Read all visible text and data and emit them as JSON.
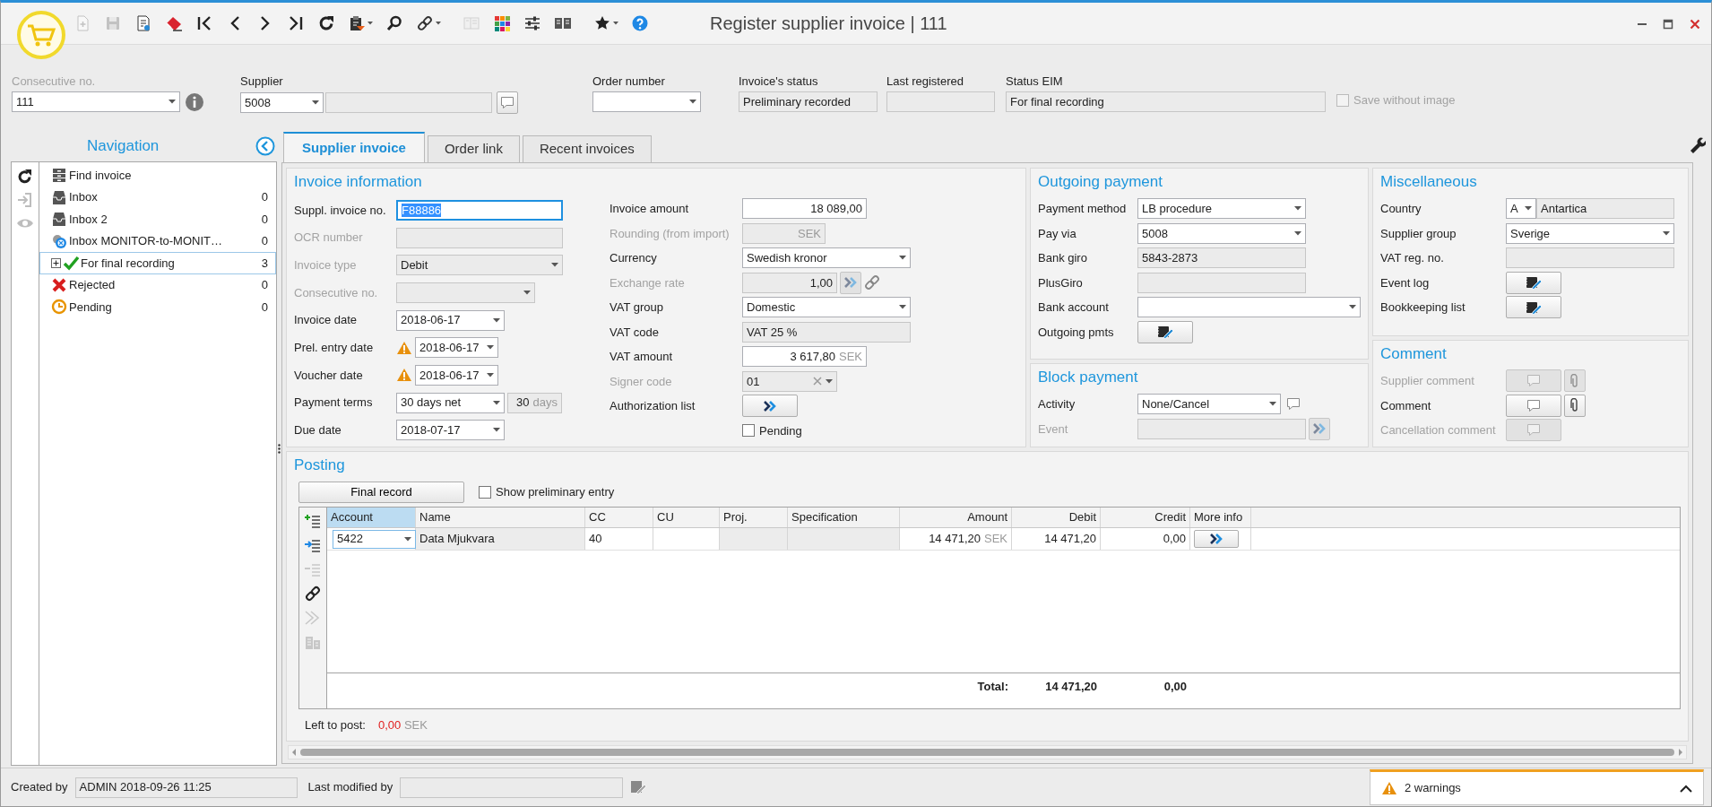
{
  "window": {
    "title": "Register supplier invoice | 111"
  },
  "toolbar": [
    {
      "disabled": true
    },
    {
      "disabled": true
    },
    {
      "disabled": false
    },
    {
      "disabled": false
    },
    {
      "disabled": false
    },
    {
      "disabled": false
    },
    {
      "disabled": false
    },
    {
      "disabled": false
    },
    {
      "disabled": false
    },
    {
      "disabled": false
    },
    {
      "disabled": false
    },
    {
      "disabled": false
    },
    {
      "disabled": true
    },
    {
      "disabled": false
    },
    {
      "disabled": false
    },
    {
      "disabled": false
    },
    {
      "disabled": false
    },
    {
      "disabled": false
    }
  ],
  "header_fields": [
    {
      "label": "Consecutive no.",
      "value": "111",
      "kind": "combo",
      "disabled": true
    },
    {
      "label": "Supplier",
      "value": "5008",
      "kind": "supplier",
      "disabled": false
    },
    {
      "label": "Order number",
      "kind": "combo",
      "disabled": false
    },
    {
      "label": "Invoice's status",
      "value": "Preliminary recorded",
      "kind": "readonly",
      "disabled": false
    },
    {
      "label": "Last registered",
      "kind": "readonly",
      "disabled": false
    },
    {
      "label": "Status EIM",
      "value": "For final recording",
      "kind": "readonly",
      "disabled": false
    }
  ],
  "save_without_image": {
    "label": "Save without image",
    "checked": false,
    "disabled": true
  },
  "navigation": {
    "title": "Navigation",
    "tools": [
      {
        "disabled": false
      },
      {
        "disabled": true
      },
      {
        "disabled": true
      }
    ],
    "items": [
      {
        "label": "Find invoice",
        "selected": false
      },
      {
        "label": "Inbox",
        "count": "0",
        "selected": false
      },
      {
        "label": "Inbox 2",
        "count": "0",
        "selected": false
      },
      {
        "label": "Inbox MONITOR-to-MONIT…",
        "count": "0",
        "selected": false
      },
      {
        "label": "For final recording",
        "count": "3",
        "selected": true,
        "expanded": false
      },
      {
        "label": "Rejected",
        "count": "0",
        "selected": false
      },
      {
        "label": "Pending",
        "count": "0",
        "selected": false
      }
    ]
  },
  "tabs": [
    {
      "label": "Supplier invoice",
      "selected": true
    },
    {
      "label": "Order link",
      "selected": false
    },
    {
      "label": "Recent invoices",
      "selected": false
    }
  ],
  "invoice_information": {
    "title": "Invoice information",
    "left": [
      {
        "label": "Suppl. invoice no.",
        "value": "F88886",
        "kind": "text",
        "focused": true,
        "disabled": false
      },
      {
        "label": "OCR number",
        "kind": "readonly",
        "disabled": true
      },
      {
        "label": "Invoice type",
        "value": "Debit",
        "kind": "combo",
        "disabled": true
      },
      {
        "label": "Consecutive no.",
        "kind": "combo",
        "disabled": true
      },
      {
        "label": "Invoice date",
        "value": "2018-06-17",
        "kind": "date",
        "warning": false,
        "disabled": false
      },
      {
        "label": "Prel. entry date",
        "value": "2018-06-17",
        "kind": "date",
        "warning": true,
        "disabled": false
      },
      {
        "label": "Voucher date",
        "value": "2018-06-17",
        "kind": "date",
        "warning": true,
        "disabled": false
      },
      {
        "label": "Payment terms",
        "value": "30 days net",
        "kind": "terms",
        "days": "30",
        "days_unit": "days",
        "disabled": false
      },
      {
        "label": "Due date",
        "value": "2018-07-17",
        "kind": "date",
        "warning": false,
        "disabled": false
      }
    ],
    "right": [
      {
        "label": "Invoice amount",
        "value": "18 089,00",
        "kind": "amount",
        "disabled": false
      },
      {
        "label": "Rounding (from import)",
        "unit": "SEK",
        "kind": "amount",
        "disabled": true
      },
      {
        "label": "Currency",
        "value": "Swedish kronor",
        "kind": "combo",
        "disabled": false
      },
      {
        "label": "Exchange rate",
        "value": "1,00",
        "kind": "rate",
        "disabled": true
      },
      {
        "label": "VAT group",
        "value": "Domestic",
        "kind": "combo",
        "disabled": false
      },
      {
        "label": "VAT code",
        "value": "VAT 25 %",
        "kind": "readonly",
        "disabled": false
      },
      {
        "label": "VAT amount",
        "value": "3 617,80",
        "unit": "SEK",
        "kind": "amount",
        "disabled": false
      },
      {
        "label": "Signer code",
        "value": "01",
        "kind": "clearcombo",
        "disabled": true
      },
      {
        "label": "Authorization list",
        "kind": "go",
        "disabled": false
      },
      {
        "label": "Pending",
        "kind": "check",
        "checked": false
      }
    ]
  },
  "outgoing_payment": {
    "title": "Outgoing payment",
    "rows": [
      {
        "label": "Payment method",
        "value": "LB procedure",
        "kind": "combo",
        "disabled": false
      },
      {
        "label": "Pay via",
        "value": "5008",
        "kind": "combo",
        "disabled": false
      },
      {
        "label": "Bank giro",
        "value": "5843-2873",
        "kind": "readonly",
        "disabled": false
      },
      {
        "label": "PlusGiro",
        "kind": "readonly",
        "disabled": false
      },
      {
        "label": "Bank account",
        "kind": "combo",
        "disabled": false
      },
      {
        "label": "Outgoing pmts",
        "kind": "edit",
        "disabled": false
      }
    ]
  },
  "block_payment": {
    "title": "Block payment",
    "rows": [
      {
        "label": "Activity",
        "value": "None/Cancel",
        "kind": "combo_note",
        "disabled": false
      },
      {
        "label": "Event",
        "kind": "readonly_go",
        "disabled": true
      }
    ]
  },
  "miscellaneous": {
    "title": "Miscellaneous",
    "rows": [
      {
        "label": "Country",
        "value": "A",
        "name": "Antartica",
        "kind": "country",
        "disabled": false
      },
      {
        "label": "Supplier group",
        "value": "Sverige",
        "kind": "combo",
        "disabled": false
      },
      {
        "label": "VAT reg. no.",
        "kind": "readonly",
        "disabled": false
      },
      {
        "label": "Event log",
        "kind": "edit",
        "disabled": false
      },
      {
        "label": "Bookkeeping list",
        "kind": "edit",
        "disabled": false
      }
    ]
  },
  "comment": {
    "title": "Comment",
    "rows": [
      {
        "label": "Supplier comment",
        "kind": "comment_attach",
        "disabled": true
      },
      {
        "label": "Comment",
        "kind": "comment_attach",
        "disabled": false
      },
      {
        "label": "Cancellation comment",
        "kind": "comment",
        "disabled": true
      }
    ]
  },
  "posting": {
    "title": "Posting",
    "final_record": "Final record",
    "show_preliminary": {
      "label": "Show preliminary entry",
      "checked": false
    },
    "tools": [
      {
        "disabled": false
      },
      {
        "disabled": false
      },
      {
        "disabled": true
      },
      {
        "disabled": false
      },
      {
        "disabled": true
      },
      {
        "disabled": true
      }
    ],
    "columns": [
      {
        "label": "Account",
        "kind": "combo",
        "selected": true
      },
      {
        "label": "Name",
        "kind": "readonly",
        "selected": false
      },
      {
        "label": "CC",
        "kind": "text",
        "selected": false
      },
      {
        "label": "CU",
        "kind": "text",
        "selected": false
      },
      {
        "label": "Proj.",
        "kind": "readonly",
        "selected": false
      },
      {
        "label": "Specification",
        "kind": "readonly",
        "selected": false
      },
      {
        "label": "Amount",
        "kind": "amount",
        "selected": false
      },
      {
        "label": "Debit",
        "kind": "number",
        "selected": false
      },
      {
        "label": "Credit",
        "kind": "number",
        "selected": false
      },
      {
        "label": "More info",
        "kind": "button",
        "selected": false
      }
    ],
    "rows": [
      {
        "cells": [
          "5422",
          "Data Mjukvara",
          "40",
          null,
          null,
          null,
          "14 471,20",
          "14 471,20",
          "0,00",
          null
        ],
        "amount_unit": "SEK"
      }
    ],
    "total_label": "Total:",
    "total_debit": "14 471,20",
    "total_credit": "0,00",
    "left_to_post": {
      "label": "Left to post:",
      "value": "0,00",
      "unit": "SEK"
    }
  },
  "footer": {
    "created_by": {
      "label": "Created by",
      "value": "ADMIN 2018-09-26 11:25"
    },
    "last_modified_by": {
      "label": "Last modified by"
    },
    "warnings": "2 warnings",
    "warnings_expanded": false
  }
}
